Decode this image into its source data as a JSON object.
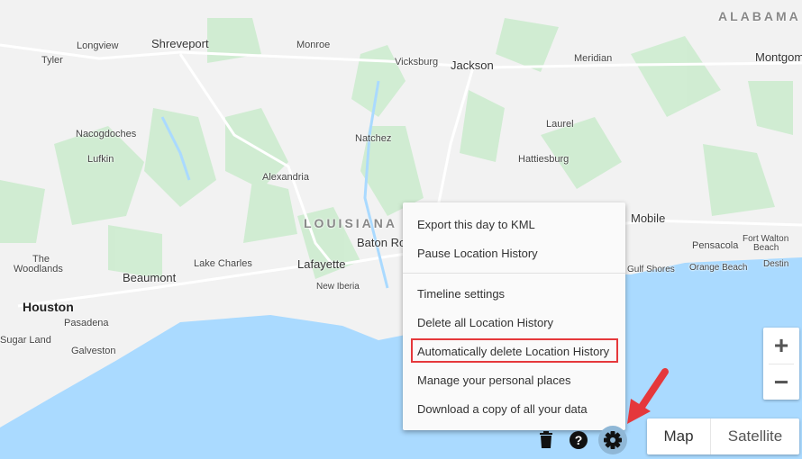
{
  "map": {
    "colors": {
      "land": "#f2f2f2",
      "forest": "#cdeccf",
      "water": "#aadaff",
      "road": "#ffffff"
    },
    "labels": {
      "alabama": "ALABAMA",
      "louisiana": "LOUISIANA",
      "shreveport": "Shreveport",
      "longview": "Longview",
      "tyler": "Tyler",
      "monroe": "Monroe",
      "vicksburg": "Vicksburg",
      "jackson": "Jackson",
      "meridian": "Meridian",
      "montgomery": "Montgom",
      "nacogdoches": "Nacogdoches",
      "lufkin": "Lufkin",
      "natchez": "Natchez",
      "laurel": "Laurel",
      "hattiesburg": "Hattiesburg",
      "alexandria": "Alexandria",
      "batonrouge": "Baton Ro",
      "mobile": "Mobile",
      "pensacola": "Pensacola",
      "fortwalton": "Fort Walton",
      "beach": "Beach",
      "destin": "Destin",
      "gulfshores": "Gulf Shores",
      "orangebeach": "Orange Beach",
      "the": "The",
      "woodlands": "Woodlands",
      "beaumont": "Beaumont",
      "lakecharles": "Lake Charles",
      "lafayette": "Lafayette",
      "newiberia": "New Iberia",
      "houston": "Houston",
      "pasadena": "Pasadena",
      "sugarland": "Sugar Land",
      "galveston": "Galveston"
    }
  },
  "menu": {
    "items": [
      "Export this day to KML",
      "Pause Location History",
      "Timeline settings",
      "Delete all Location History",
      "Automatically delete Location History",
      "Manage your personal places",
      "Download a copy of all your data"
    ],
    "highlighted_index": 4,
    "highlight_color": "#e5383b"
  },
  "toolbar": {
    "icons": [
      "trash-icon",
      "help-icon",
      "gear-icon"
    ]
  },
  "zoom": {
    "plus": "+",
    "minus": "−"
  },
  "map_type": {
    "map": "Map",
    "satellite": "Satellite"
  },
  "annotation": {
    "arrow_color": "#e5383b"
  }
}
